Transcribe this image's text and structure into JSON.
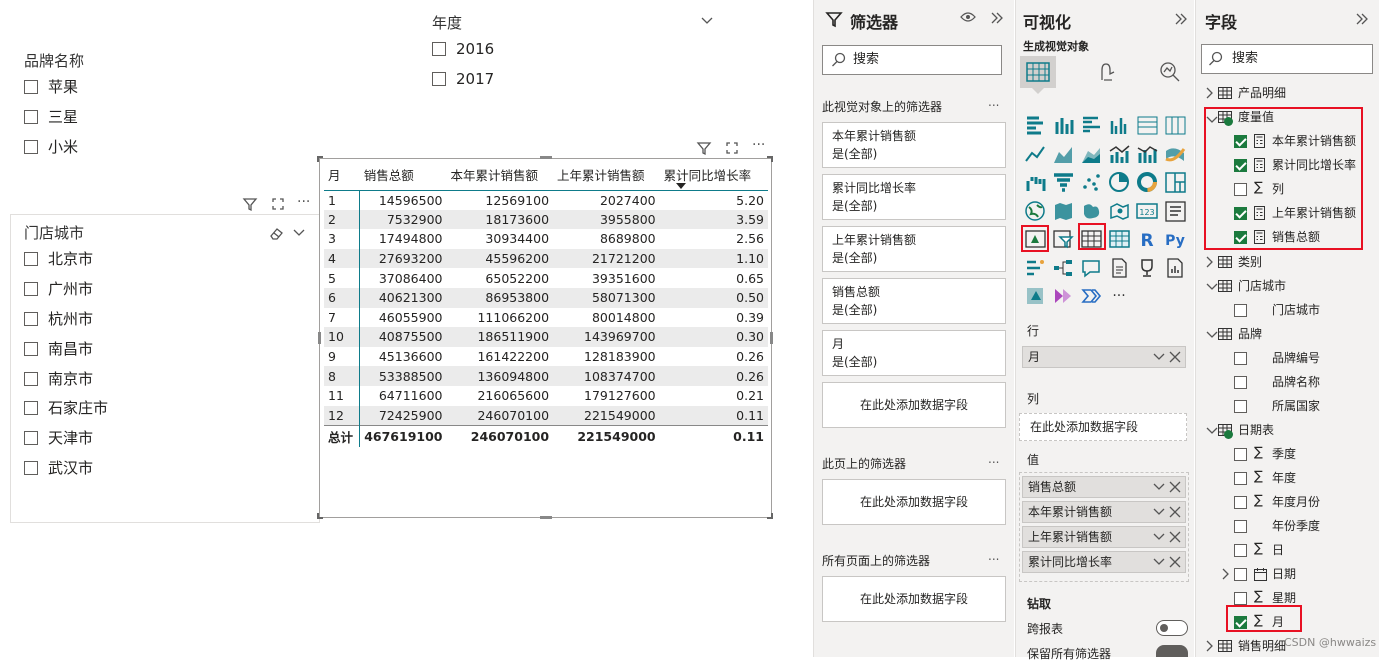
{
  "brand_slicer": {
    "title": "品牌名称",
    "items": [
      "苹果",
      "三星",
      "小米"
    ]
  },
  "year_slicer": {
    "title": "年度",
    "items": [
      "2016",
      "2017"
    ]
  },
  "city_slicer": {
    "title": "门店城市",
    "items": [
      "北京市",
      "广州市",
      "杭州市",
      "南昌市",
      "南京市",
      "石家庄市",
      "天津市",
      "武汉市"
    ]
  },
  "table": {
    "headers": [
      "月",
      "销售总额",
      "本年累计销售额",
      "上年累计销售额",
      "累计同比增长率"
    ],
    "rows": [
      [
        "1",
        "14596500",
        "12569100",
        "2027400",
        "5.20"
      ],
      [
        "2",
        "7532900",
        "18173600",
        "3955800",
        "3.59"
      ],
      [
        "3",
        "17494800",
        "30934400",
        "8689800",
        "2.56"
      ],
      [
        "4",
        "27693200",
        "45596200",
        "21721200",
        "1.10"
      ],
      [
        "5",
        "37086400",
        "65052200",
        "39351600",
        "0.65"
      ],
      [
        "6",
        "40621300",
        "86953800",
        "58071300",
        "0.50"
      ],
      [
        "7",
        "46055900",
        "111066200",
        "80014800",
        "0.39"
      ],
      [
        "10",
        "40875500",
        "186511900",
        "143969700",
        "0.30"
      ],
      [
        "9",
        "45136600",
        "161422200",
        "128183900",
        "0.26"
      ],
      [
        "8",
        "53388500",
        "136094800",
        "108374700",
        "0.26"
      ],
      [
        "11",
        "64711600",
        "216065600",
        "179127600",
        "0.21"
      ],
      [
        "12",
        "72425900",
        "246070100",
        "221549000",
        "0.11"
      ]
    ],
    "total": [
      "总计",
      "467619100",
      "246070100",
      "221549000",
      "0.11"
    ]
  },
  "filters_pane": {
    "title": "筛选器",
    "search_placeholder": "搜索",
    "visual_section": "此视觉对象上的筛选器",
    "cards": [
      {
        "name": "本年累计销售额",
        "state": "是(全部)"
      },
      {
        "name": "累计同比增长率",
        "state": "是(全部)"
      },
      {
        "name": "上年累计销售额",
        "state": "是(全部)"
      },
      {
        "name": "销售总额",
        "state": "是(全部)"
      },
      {
        "name": "月",
        "state": "是(全部)"
      }
    ],
    "add_field": "在此处添加数据字段",
    "page_section": "此页上的筛选器",
    "all_pages_section": "所有页面上的筛选器",
    "more": "..."
  },
  "viz_pane": {
    "title": "可视化",
    "build_label": "生成视觉对象",
    "rows_label": "行",
    "rows_value": "月",
    "cols_label": "列",
    "cols_add": "在此处添加数据字段",
    "values_label": "值",
    "values": [
      "销售总额",
      "本年累计销售额",
      "上年累计销售额",
      "累计同比增长率"
    ],
    "drill_label": "钻取",
    "cross_report": "跨报表",
    "keep_filters": "保留所有筛选器",
    "r_label": "R",
    "py_label": "Py",
    "num_label": "123",
    "more_dots": "···"
  },
  "fields_pane": {
    "title": "字段",
    "search_placeholder": "搜索",
    "tables": {
      "product": "产品明细",
      "measures": "度量值",
      "category": "类别",
      "store": "门店城市",
      "brand": "品牌",
      "date": "日期表",
      "sales": "销售明细"
    },
    "measure_fields": [
      "本年累计销售额",
      "累计同比增长率",
      "列",
      "上年累计销售额",
      "销售总额"
    ],
    "store_fields": [
      "门店城市"
    ],
    "brand_fields": [
      "品牌编号",
      "品牌名称",
      "所属国家"
    ],
    "date_fields": [
      "季度",
      "年度",
      "年度月份",
      "年份季度",
      "日",
      "日期",
      "星期",
      "月"
    ]
  },
  "watermark": "CSDN @hwwaizs",
  "colors": {
    "accent": "#0e7b8a",
    "highlight": "#e81123",
    "check": "#1b7a3e",
    "pane": "#f3f2f1"
  }
}
